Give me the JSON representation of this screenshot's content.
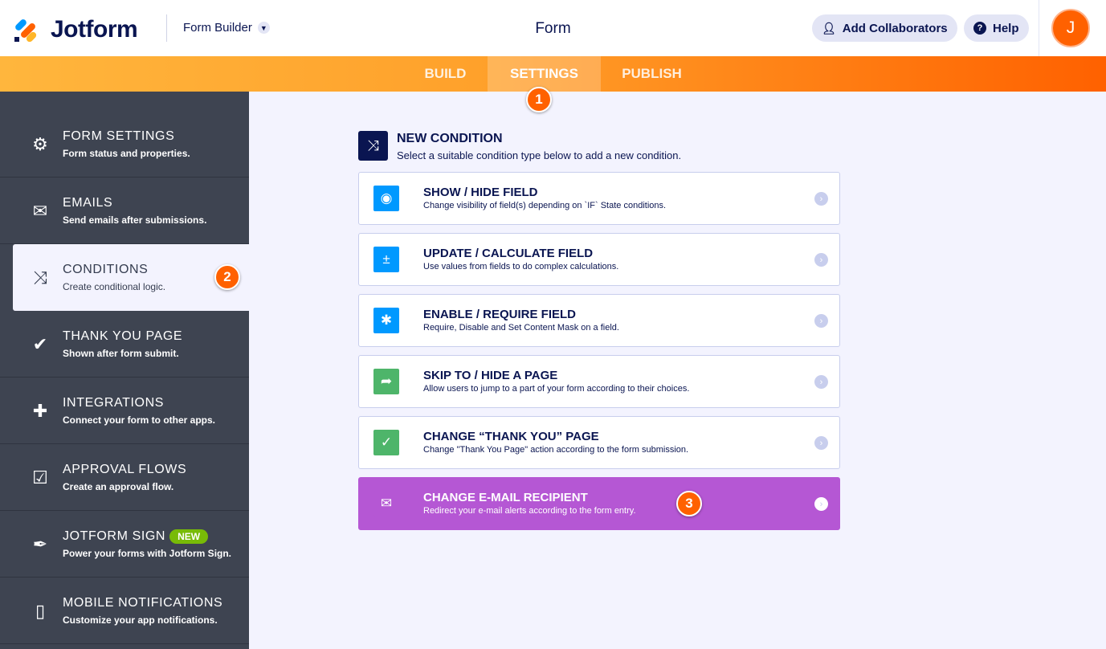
{
  "header": {
    "logo": "Jotform",
    "builder_label": "Form Builder",
    "title": "Form",
    "collaborators_label": "Add Collaborators",
    "help_label": "Help",
    "avatar_initial": "J"
  },
  "tabs": [
    {
      "label": "BUILD"
    },
    {
      "label": "SETTINGS"
    },
    {
      "label": "PUBLISH"
    }
  ],
  "active_tab": "SETTINGS",
  "steps": [
    "1",
    "2",
    "3"
  ],
  "sidebar": {
    "items": [
      {
        "title": "FORM SETTINGS",
        "desc": "Form status and properties.",
        "icon": "gear-icon",
        "glyph": "⚙"
      },
      {
        "title": "EMAILS",
        "desc": "Send emails after submissions.",
        "icon": "envelope-icon",
        "glyph": "✉"
      },
      {
        "title": "CONDITIONS",
        "desc": "Create conditional logic.",
        "icon": "shuffle-icon",
        "glyph": "⤨"
      },
      {
        "title": "THANK YOU PAGE",
        "desc": "Shown after form submit.",
        "icon": "check-circle-icon",
        "glyph": "✔"
      },
      {
        "title": "INTEGRATIONS",
        "desc": "Connect your form to other apps.",
        "icon": "puzzle-icon",
        "glyph": "✚"
      },
      {
        "title": "APPROVAL FLOWS",
        "desc": "Create an approval flow.",
        "icon": "approval-icon",
        "glyph": "☑"
      },
      {
        "title": "JOTFORM SIGN",
        "desc": "Power your forms with Jotform Sign.",
        "icon": "pen-icon",
        "glyph": "✒",
        "badge": "NEW"
      },
      {
        "title": "MOBILE NOTIFICATIONS",
        "desc": "Customize your app notifications.",
        "icon": "mobile-icon",
        "glyph": "▯"
      }
    ],
    "active": "CONDITIONS"
  },
  "new_condition": {
    "title": "NEW CONDITION",
    "desc": "Select a suitable condition type below to add a new condition."
  },
  "conditions": [
    {
      "title": "SHOW / HIDE FIELD",
      "desc": "Change visibility of field(s) depending on `IF` State conditions.",
      "icon": "eye-icon",
      "glyph": "◉",
      "color": "#0099ff"
    },
    {
      "title": "UPDATE / CALCULATE FIELD",
      "desc": "Use values from fields to do complex calculations.",
      "icon": "calculator-icon",
      "glyph": "±",
      "color": "#0099ff"
    },
    {
      "title": "ENABLE / REQUIRE FIELD",
      "desc": "Require, Disable and Set Content Mask on a field.",
      "icon": "asterisk-icon",
      "glyph": "✱",
      "color": "#0099ff"
    },
    {
      "title": "SKIP TO / HIDE A PAGE",
      "desc": "Allow users to jump to a part of your form according to their choices.",
      "icon": "forward-arrow-icon",
      "glyph": "➦",
      "color": "#4eb56a"
    },
    {
      "title": "CHANGE “THANK YOU” PAGE",
      "desc": "Change \"Thank You Page\" action according to the form submission.",
      "icon": "check-circle-icon",
      "glyph": "✓",
      "color": "#4eb56a"
    },
    {
      "title": "CHANGE E-MAIL RECIPIENT",
      "desc": "Redirect your e-mail alerts according to the form entry.",
      "icon": "envelope-icon",
      "glyph": "✉",
      "color": "#b557d4"
    }
  ],
  "colors": {
    "accent": "#ff6100",
    "navy": "#0a1551",
    "sidebar": "#3e4451",
    "highlight": "#b557d4"
  }
}
